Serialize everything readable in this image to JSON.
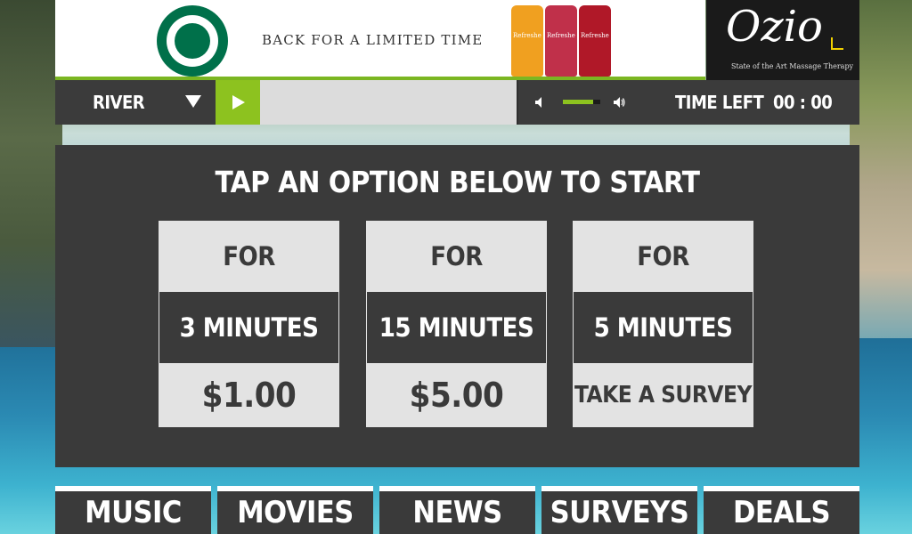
{
  "ad": {
    "tagline": "Back for a limited time",
    "brand_logo": "starbucks-siren-logo",
    "cans": [
      {
        "label": "Refreshers",
        "color": "#f0a020"
      },
      {
        "label": "Refreshers",
        "color": "#c0304a"
      },
      {
        "label": "Refreshers",
        "color": "#b01828"
      }
    ],
    "sponsor_name": "Ozio",
    "sponsor_tagline": "State of the Art Massage Therapy"
  },
  "player": {
    "station": "RIVER",
    "volume_level": 0.8,
    "time_left_label": "TIME LEFT",
    "time_left_value": "00 : 00"
  },
  "panel": {
    "title": "TAP AN OPTION BELOW TO START",
    "options": [
      {
        "prefix": "FOR",
        "duration": "3 MINUTES",
        "price": "$1.00"
      },
      {
        "prefix": "FOR",
        "duration": "15 MINUTES",
        "price": "$5.00"
      },
      {
        "prefix": "FOR",
        "duration": "5 MINUTES",
        "price": "TAKE A SURVEY"
      }
    ]
  },
  "nav": {
    "items": [
      "MUSIC",
      "MOVIES",
      "NEWS",
      "SURVEYS",
      "DEALS"
    ]
  },
  "colors": {
    "accent": "#8dc21f",
    "panel": "#3a3a3a",
    "option_bg": "#e3e3e3"
  }
}
